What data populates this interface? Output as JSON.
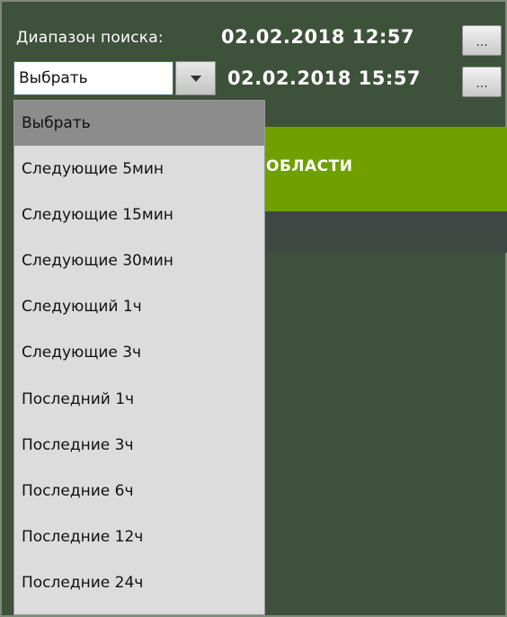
{
  "header": {
    "range_label": "Диапазон поиска:",
    "start_datetime": "02.02.2018  12:57",
    "end_datetime": "02.02.2018  15:57",
    "browse_button_label": "..."
  },
  "select": {
    "value": "Выбрать",
    "arrow_icon": "chevron-down-icon"
  },
  "dropdown": {
    "items": [
      "Выбрать",
      "Следующие 5мин",
      "Следующие 15мин",
      "Следующие 30мин",
      "Следующий 1ч",
      "Следующие 3ч",
      "Последний 1ч",
      "Последние 3ч",
      "Последние 6ч",
      "Последние 12ч",
      "Последние 24ч"
    ],
    "selected_index": 0
  },
  "panel": {
    "green_label": "ОБЛАСТИ"
  },
  "colors": {
    "background": "#3e513a",
    "accent_green": "#6fa000",
    "dropdown_bg": "#dcdcdc",
    "selected_bg": "#8c8c8c"
  }
}
